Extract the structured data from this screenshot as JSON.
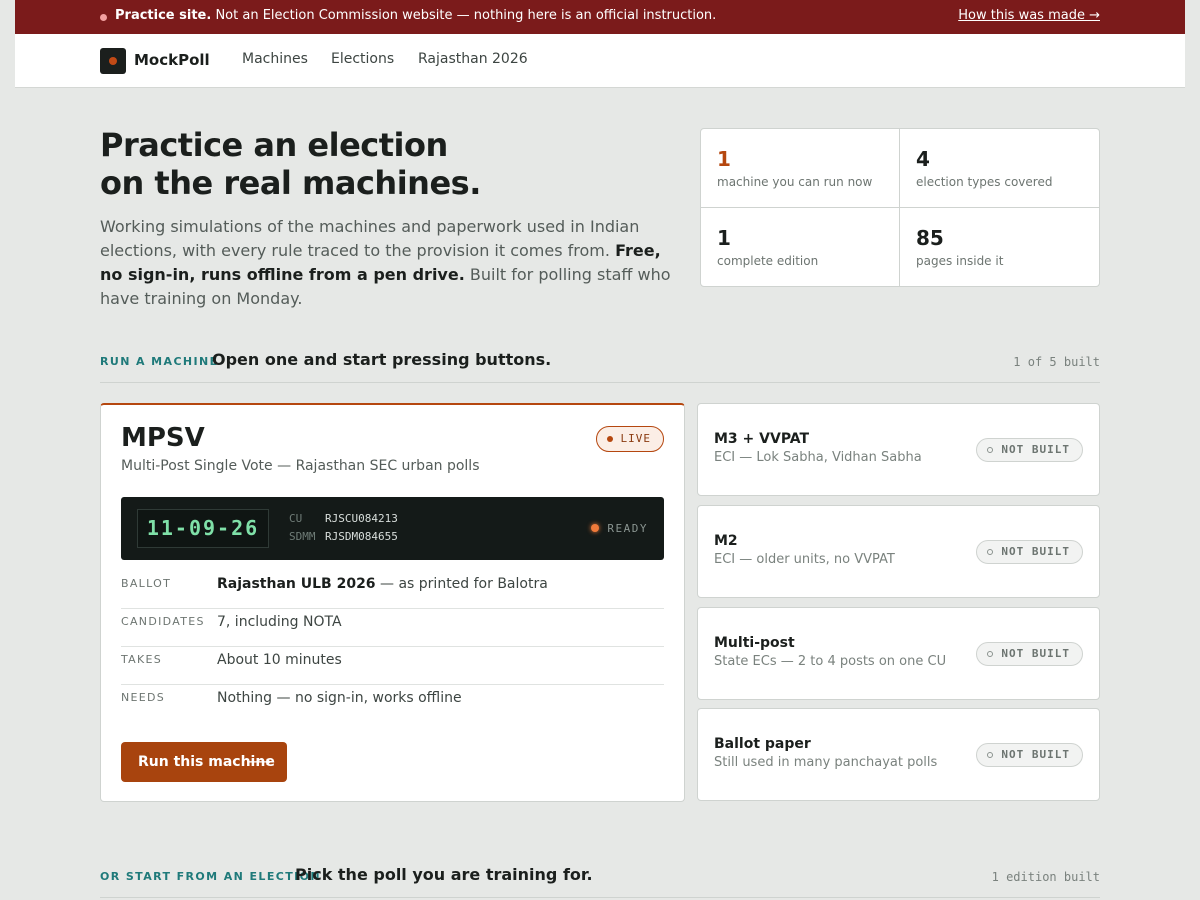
{
  "banner": {
    "strong": "Practice site.",
    "text": " Not an Election Commission website — nothing here is an official instruction.",
    "link": "How this was made →"
  },
  "nav": {
    "brand": "MockPoll",
    "links": [
      "Machines",
      "Elections",
      "Rajasthan 2026"
    ]
  },
  "hero": {
    "title_line1": "Practice an election",
    "title_line2": "on the real machines.",
    "desc_part1": "Working simulations of the machines and paperwork used in Indian elections, with every rule traced to the provision it comes from. ",
    "desc_bold": "Free, no sign-in, runs offline from a pen drive.",
    "desc_part2": " Built for polling staff who have training on Monday."
  },
  "stats": [
    {
      "num": "1",
      "label": "machine you can run now"
    },
    {
      "num": "4",
      "label": "election types covered"
    },
    {
      "num": "1",
      "label": "complete edition"
    },
    {
      "num": "85",
      "label": "pages inside it"
    }
  ],
  "section_machines": {
    "eyebrow": "RUN A MACHINE",
    "title": "Open one and start pressing buttons.",
    "count": "1 of 5 built"
  },
  "main_machine": {
    "title": "MPSV",
    "subtitle": "Multi-Post Single Vote — Rajasthan SEC urban polls",
    "badge": "LIVE",
    "display": "11-09-26",
    "cu_label": "CU",
    "cu_value": "RJSCU084213",
    "sdmm_label": "SDMM",
    "sdmm_value": "RJSDM084655",
    "status": "READY",
    "specs": [
      {
        "key": "BALLOT",
        "value_bold": "Rajasthan ULB 2026",
        "value": " — as printed for Balotra"
      },
      {
        "key": "CANDIDATES",
        "value_bold": "",
        "value": "7, including NOTA"
      },
      {
        "key": "TAKES",
        "value_bold": "",
        "value": "About 10 minutes"
      },
      {
        "key": "NEEDS",
        "value_bold": "",
        "value": "Nothing — no sign-in, works offline"
      }
    ],
    "button": "Run this machine",
    "button_arrow": "⟶"
  },
  "other_machines": [
    {
      "title": "M3 + VVPAT",
      "subtitle": "ECI — Lok Sabha, Vidhan Sabha",
      "badge": "NOT BUILT"
    },
    {
      "title": "M2",
      "subtitle": "ECI — older units, no VVPAT",
      "badge": "NOT BUILT"
    },
    {
      "title": "Multi-post",
      "subtitle": "State ECs — 2 to 4 posts on one CU",
      "badge": "NOT BUILT"
    },
    {
      "title": "Ballot paper",
      "subtitle": "Still used in many panchayat polls",
      "badge": "NOT BUILT"
    }
  ],
  "section_elections": {
    "eyebrow": "OR START FROM AN ELECTION",
    "title": "Pick the poll you are training for.",
    "count": "1 edition built"
  }
}
